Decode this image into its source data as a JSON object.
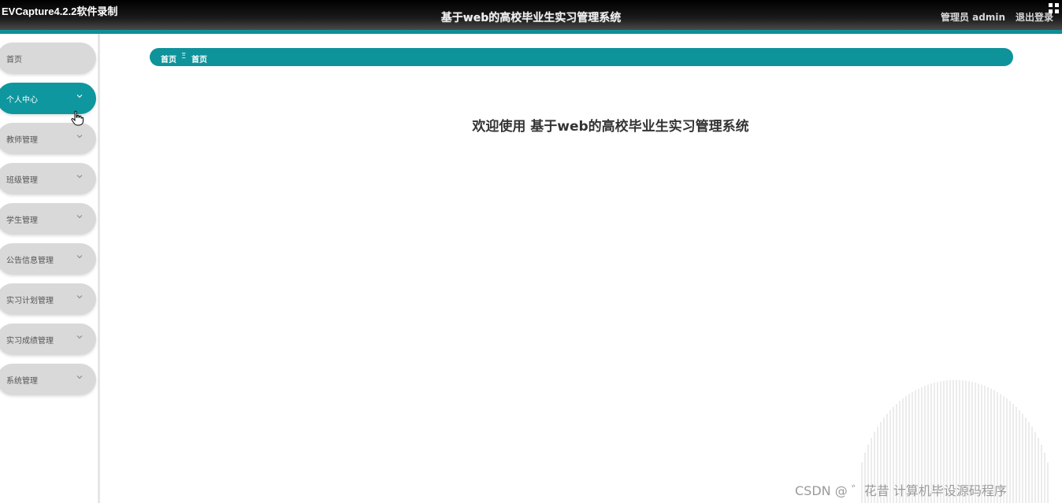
{
  "recorder_watermark": "EVCapture4.2.2软件录制",
  "header": {
    "title": "基于web的高校毕业生实习管理系统",
    "user_label": "管理员 admin",
    "logout_label": "退出登录"
  },
  "sidebar": {
    "items": [
      {
        "label": "首页",
        "has_chevron": false,
        "active": false
      },
      {
        "label": "个人中心",
        "has_chevron": true,
        "active": true
      },
      {
        "label": "教师管理",
        "has_chevron": true,
        "active": false
      },
      {
        "label": "班级管理",
        "has_chevron": true,
        "active": false
      },
      {
        "label": "学生管理",
        "has_chevron": true,
        "active": false
      },
      {
        "label": "公告信息管理",
        "has_chevron": true,
        "active": false
      },
      {
        "label": "实习计划管理",
        "has_chevron": true,
        "active": false
      },
      {
        "label": "实习成绩管理",
        "has_chevron": true,
        "active": false
      },
      {
        "label": "系统管理",
        "has_chevron": true,
        "active": false
      }
    ]
  },
  "breadcrumb": {
    "root": "首页",
    "separator": "Ξ",
    "current": "首页"
  },
  "main": {
    "welcome": "欢迎使用 基于web的高校毕业生实习管理系统"
  },
  "csdn_watermark": "CSDN @ ゛花昔 计算机毕设源码程序",
  "colors": {
    "accent": "#0e979e",
    "sidebar_item": "#d9d9d9"
  }
}
